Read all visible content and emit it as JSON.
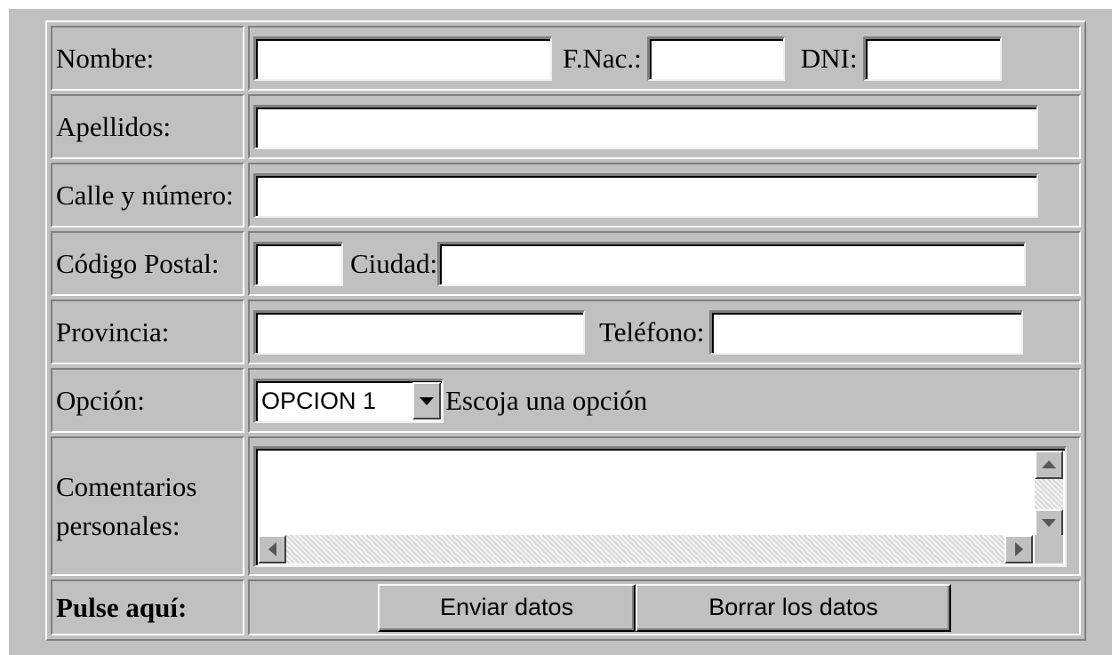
{
  "form": {
    "rows": {
      "nombre": {
        "label": "Nombre:",
        "value": ""
      },
      "fnac": {
        "label": "F.Nac.:",
        "value": ""
      },
      "dni": {
        "label": "DNI:",
        "value": ""
      },
      "apellidos": {
        "label": "Apellidos:",
        "value": ""
      },
      "calle": {
        "label": "Calle y número:",
        "value": ""
      },
      "codigo_postal": {
        "label": "Código Postal:",
        "value": ""
      },
      "ciudad": {
        "label": "Ciudad:",
        "value": ""
      },
      "provincia": {
        "label": "Provincia:",
        "value": ""
      },
      "telefono": {
        "label": "Teléfono:",
        "value": ""
      },
      "opcion": {
        "label": "Opción:",
        "selected": "OPCION 1",
        "hint": "Escoja una opción"
      },
      "comentarios": {
        "label_line1": "Comentarios",
        "label_line2": "personales:",
        "value": ""
      },
      "submit": {
        "label": "Pulse aquí:",
        "send_button": "Enviar datos",
        "reset_button": "Borrar los datos"
      }
    }
  },
  "colors": {
    "background": "#c0c0c0",
    "field": "#ffffff",
    "border_dark": "#808080",
    "border_light": "#ffffff"
  },
  "icons": {
    "select_arrow": "chevron-down-icon",
    "scroll_up": "scroll-up-icon",
    "scroll_down": "scroll-down-icon",
    "scroll_left": "scroll-left-icon",
    "scroll_right": "scroll-right-icon"
  }
}
